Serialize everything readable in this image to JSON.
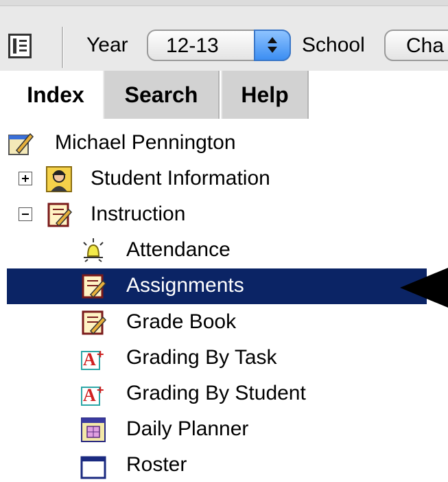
{
  "toolbar": {
    "year_label": "Year",
    "year_value": "12-13",
    "school_label": "School",
    "school_value": "Cha"
  },
  "tabs": [
    {
      "label": "Index",
      "active": true
    },
    {
      "label": "Search",
      "active": false
    },
    {
      "label": "Help",
      "active": false
    }
  ],
  "tree": {
    "root": {
      "label": "Michael Pennington",
      "icon": "edit-notebook-icon"
    },
    "items": [
      {
        "label": "Student Information",
        "icon": "student-icon",
        "expander": "plus"
      },
      {
        "label": "Instruction",
        "icon": "notebook-icon",
        "expander": "minus"
      },
      {
        "label": "Attendance",
        "icon": "attendance-bell-icon"
      },
      {
        "label": "Assignments",
        "icon": "notebook-icon",
        "selected": true
      },
      {
        "label": "Grade Book",
        "icon": "notebook-icon"
      },
      {
        "label": "Grading By Task",
        "icon": "grade-a-plus-icon"
      },
      {
        "label": "Grading By Student",
        "icon": "grade-a-plus-icon"
      },
      {
        "label": "Daily Planner",
        "icon": "calendar-icon"
      },
      {
        "label": "Roster",
        "icon": "roster-icon"
      }
    ]
  },
  "colors": {
    "selection": "#0b2465",
    "toolbar_bg": "#e9e9e9",
    "tab_inactive": "#d2d2d2"
  }
}
